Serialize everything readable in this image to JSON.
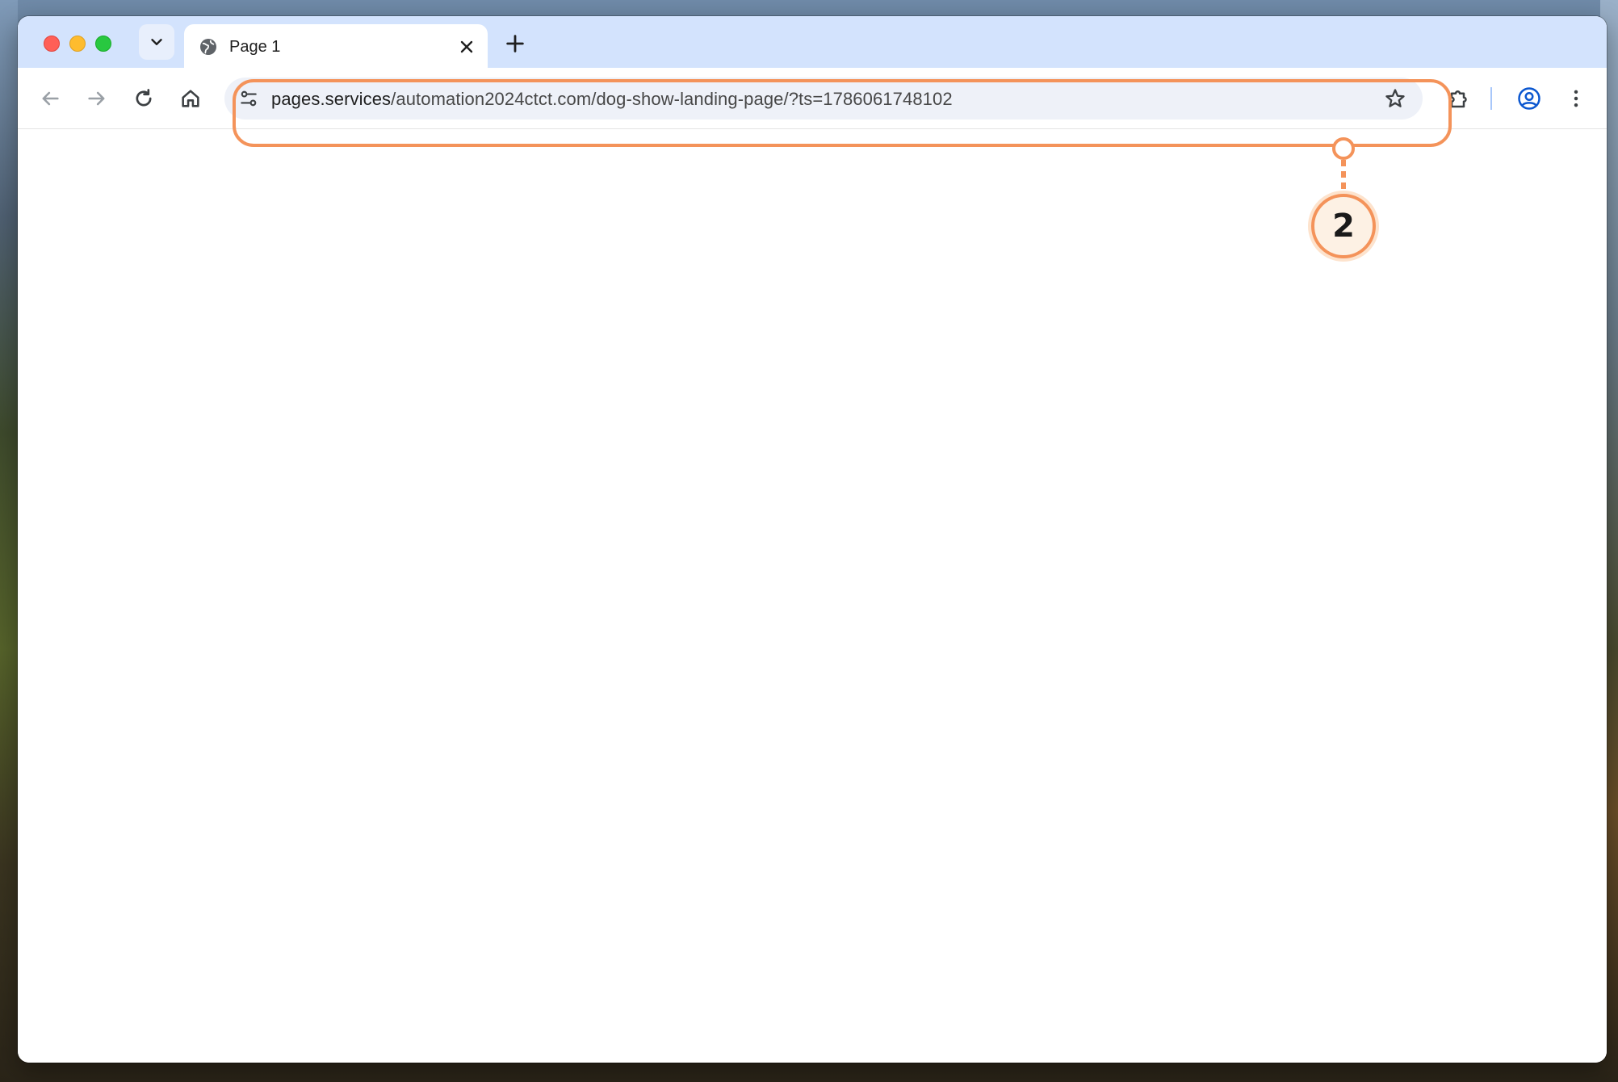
{
  "tabs": [
    {
      "title": "Page 1",
      "active": true
    }
  ],
  "toolbar": {
    "url_host": "pages.services",
    "url_rest": "/automation2024ctct.com/dog-show-landing-page/?ts=1786061748102"
  },
  "annotation": {
    "callout_number": "2",
    "color": "#f4935a"
  },
  "icons": {
    "tab_search": "chevron-down-icon",
    "favicon": "globe-icon",
    "tab_close": "close-icon",
    "new_tab": "plus-icon",
    "back": "arrow-left-icon",
    "forward": "arrow-right-icon",
    "reload": "reload-icon",
    "home": "home-icon",
    "site_info": "tune-icon",
    "bookmark": "star-icon",
    "extensions": "puzzle-icon",
    "profile": "profile-icon",
    "menu": "kebab-icon"
  },
  "colors": {
    "tabstrip": "#d3e3fd",
    "omnibox": "#eef1f8",
    "profile_accent": "#0b57d0"
  }
}
